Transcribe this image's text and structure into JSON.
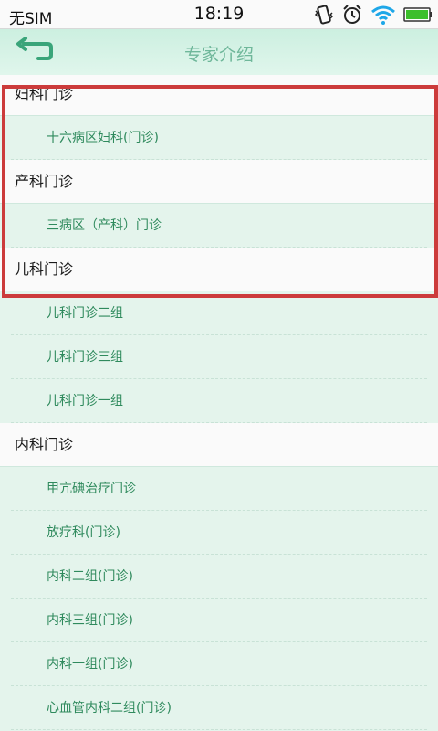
{
  "status_bar": {
    "carrier": "无SIM",
    "time": "18:19",
    "icons": [
      "vibrate-icon",
      "alarm-icon",
      "wifi-icon",
      "battery-icon"
    ]
  },
  "header": {
    "title": "专家介绍",
    "back_icon": "back-arrow-icon"
  },
  "colors": {
    "accent": "#2f8a5d",
    "title": "#6fb79a",
    "background": "#e4f4ec",
    "highlight": "#cc3b3b"
  },
  "list": [
    {
      "type": "header",
      "label": "妇科门诊"
    },
    {
      "type": "sub",
      "label": "十六病区妇科(门诊)"
    },
    {
      "type": "header",
      "label": "产科门诊"
    },
    {
      "type": "sub",
      "label": "三病区（产科）门诊"
    },
    {
      "type": "header",
      "label": "儿科门诊"
    },
    {
      "type": "sub",
      "label": "儿科门诊二组"
    },
    {
      "type": "sub",
      "label": "儿科门诊三组"
    },
    {
      "type": "sub",
      "label": "儿科门诊一组"
    },
    {
      "type": "header",
      "label": "内科门诊"
    },
    {
      "type": "sub",
      "label": "甲亢碘治疗门诊"
    },
    {
      "type": "sub",
      "label": "放疗科(门诊)"
    },
    {
      "type": "sub",
      "label": "内科二组(门诊)"
    },
    {
      "type": "sub",
      "label": "内科三组(门诊)"
    },
    {
      "type": "sub",
      "label": "内科一组(门诊)"
    },
    {
      "type": "sub",
      "label": "心血管内科二组(门诊)"
    }
  ]
}
